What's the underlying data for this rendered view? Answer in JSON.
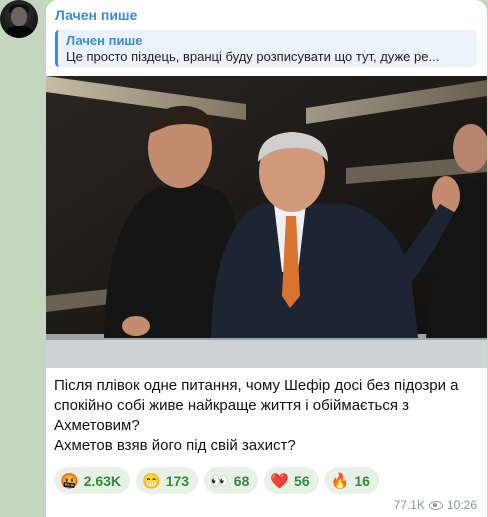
{
  "message": {
    "sender": "Лачен пише",
    "reply": {
      "name": "Лачен пише",
      "text": "Це просто піздець, вранці буду розписувати що тут, дуже ре..."
    },
    "caption_lines": [
      "Після плівок одне питання, чому Шефір досі без підозри а спокійно собі живе найкраще життя і обіймається з Ахметовим?",
      "Ахметов взяв його під свій захист?"
    ],
    "reactions": [
      {
        "emoji": "🤬",
        "count": "2.63K"
      },
      {
        "emoji": "😁",
        "count": "173"
      },
      {
        "emoji": "👀",
        "count": "68"
      },
      {
        "emoji": "❤️",
        "count": "56"
      },
      {
        "emoji": "🔥",
        "count": "16"
      }
    ],
    "views": "77.1K",
    "time": "10:26"
  },
  "colors": {
    "accent": "#3a8fd1",
    "reaction_text": "#2f8a3a",
    "chat_background": "#c4d6c0"
  }
}
